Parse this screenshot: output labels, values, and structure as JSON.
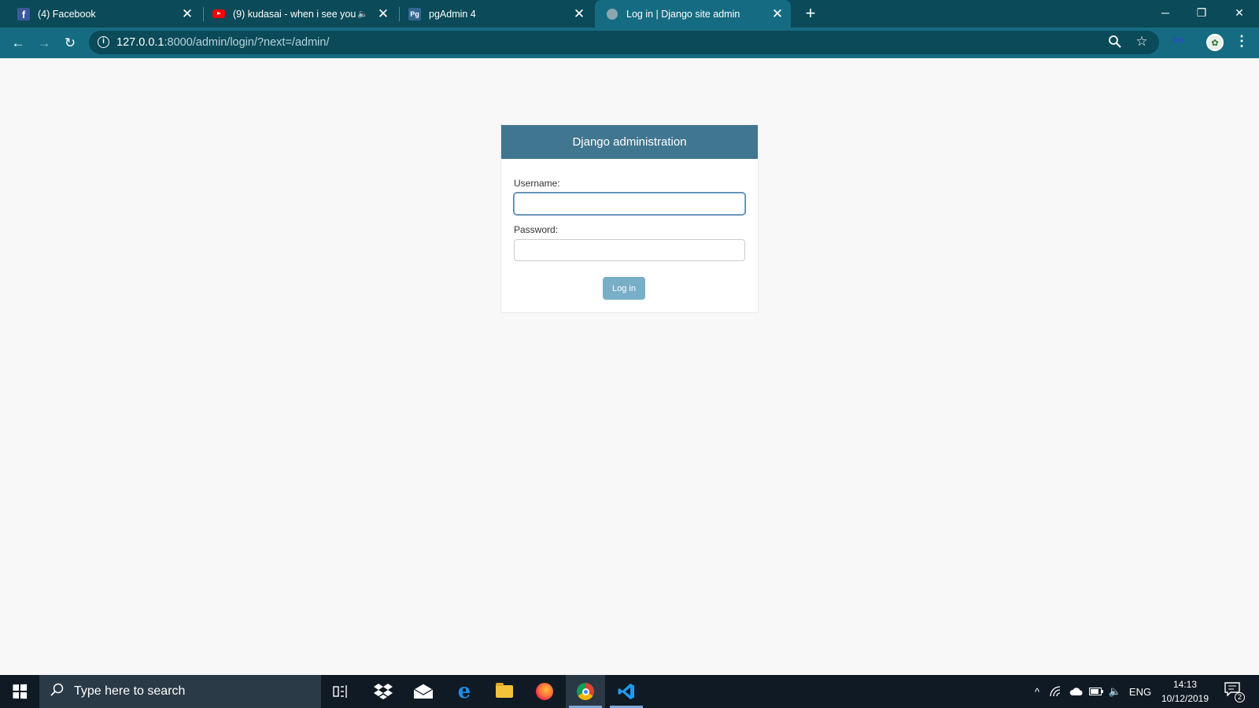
{
  "browser": {
    "tabs": [
      {
        "title": "(4) Facebook",
        "icon": "facebook-icon"
      },
      {
        "title": "(9) kudasai - when i see you",
        "icon": "youtube-icon",
        "audio": "speaker-icon"
      },
      {
        "title": "pgAdmin 4",
        "icon": "pgadmin-icon",
        "icon_text": "Pg"
      },
      {
        "title": "Log in | Django site admin",
        "icon": "globe-icon",
        "active": true
      }
    ],
    "new_tab_label": "+",
    "url_host": "127.0.0.1",
    "url_rest": ":8000/admin/login/?next=/admin/",
    "extension_label": "Inv",
    "colors": {
      "tabstrip": "#0b4a58",
      "toolbar": "#156c82",
      "active_tab": "#156c82"
    }
  },
  "login": {
    "header": "Django administration",
    "username_label": "Username:",
    "username_value": "",
    "password_label": "Password:",
    "password_value": "",
    "submit_label": "Log in",
    "colors": {
      "header": "#417690",
      "button": "#79aec8"
    }
  },
  "taskbar": {
    "search_placeholder": "Type here to search",
    "pinned_apps": [
      "task-view-icon",
      "dropbox-icon",
      "mail-icon",
      "edge-icon",
      "file-explorer-icon",
      "firefox-icon",
      "chrome-icon",
      "vscode-icon"
    ],
    "active_app": "chrome-icon",
    "language": "ENG",
    "time": "14:13",
    "date": "10/12/2019",
    "notification_count": "2"
  }
}
